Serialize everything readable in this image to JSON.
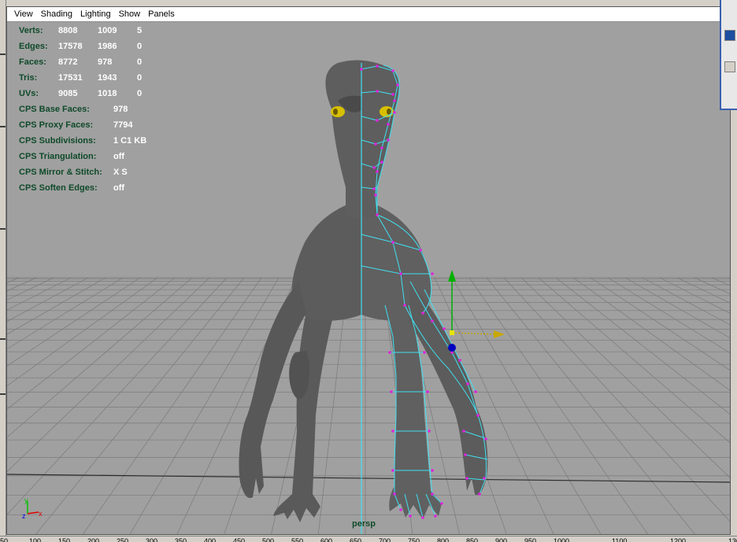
{
  "menu": {
    "items": [
      "View",
      "Shading",
      "Lighting",
      "Show",
      "Panels"
    ]
  },
  "hud": {
    "poly": [
      {
        "label": "Verts:",
        "c1": "8808",
        "c2": "1009",
        "c3": "5"
      },
      {
        "label": "Edges:",
        "c1": "17578",
        "c2": "1986",
        "c3": "0"
      },
      {
        "label": "Faces:",
        "c1": "8772",
        "c2": "978",
        "c3": "0"
      },
      {
        "label": "Tris:",
        "c1": "17531",
        "c2": "1943",
        "c3": "0"
      },
      {
        "label": "UVs:",
        "c1": "9085",
        "c2": "1018",
        "c3": "0"
      }
    ],
    "cps": [
      {
        "label": "CPS Base Faces:",
        "value": "978"
      },
      {
        "label": "CPS Proxy Faces:",
        "value": "7794"
      },
      {
        "label": "CPS Subdivisions:",
        "value": "1 C1 KB"
      },
      {
        "label": "CPS Triangulation:",
        "value": "off"
      },
      {
        "label": "CPS Mirror & Stitch:",
        "value": "X S"
      },
      {
        "label": "CPS Soften Edges:",
        "value": "off"
      }
    ]
  },
  "camera": "persp",
  "axes": {
    "x": "x",
    "y": "y",
    "z": "z"
  },
  "timeline": {
    "ticks": [
      "50",
      "100",
      "150",
      "200",
      "250",
      "300",
      "350",
      "400",
      "450",
      "500",
      "550",
      "600",
      "650",
      "700",
      "750",
      "800",
      "850",
      "900",
      "950",
      "1000",
      "",
      "1100",
      "",
      "1200",
      "",
      "1300",
      "",
      "1400",
      "",
      "1500",
      "",
      "16"
    ]
  },
  "colors": {
    "viewport_bg": "#a0a0a0",
    "grid": "#7a7a7a",
    "hud_label": "#0f4a2a",
    "hud_value": "#ffffff",
    "wireframe": "#40e0f0",
    "vertex": "#e020e0",
    "model": "#5c5c5c",
    "eye": "#d8c000",
    "manip_y": "#00b000",
    "manip_x": "#c8a800",
    "manip_z": "#0000c0"
  },
  "icons": {
    "manipulator": "move-manipulator-icon",
    "axis": "axis-indicator-icon"
  }
}
